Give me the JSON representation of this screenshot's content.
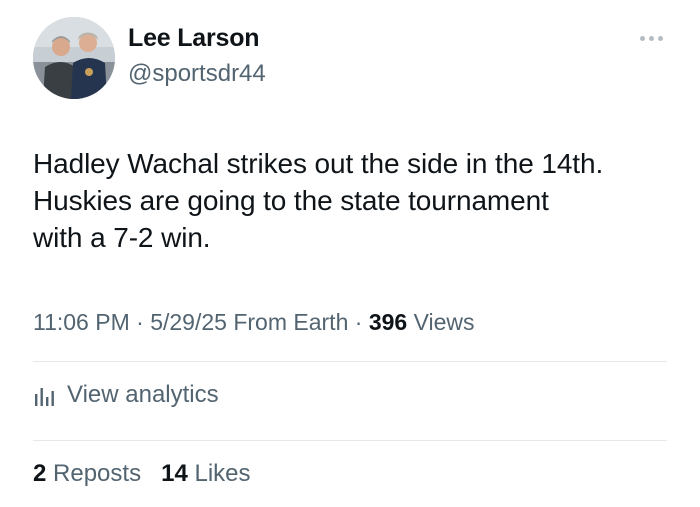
{
  "author": {
    "name": "Lee Larson",
    "handle": "@sportsdr44"
  },
  "tweet": {
    "lines": [
      "Hadley Wachal strikes out the side in the 14th.",
      "Huskies are going to the state tournament",
      "with a 7-2 win."
    ]
  },
  "meta": {
    "time": "11:06 PM",
    "date": "5/29/25",
    "source": "From Earth",
    "views_count": "396",
    "views_label": "Views",
    "separator": " · "
  },
  "analytics": {
    "label": "View analytics",
    "icon": "analytics-bars-icon"
  },
  "engagement": {
    "reposts_count": "2",
    "reposts_label": "Reposts",
    "likes_count": "14",
    "likes_label": "Likes"
  },
  "colors": {
    "primary_text": "#0f1419",
    "secondary_text": "#536471",
    "divider": "#e6e9eb"
  }
}
